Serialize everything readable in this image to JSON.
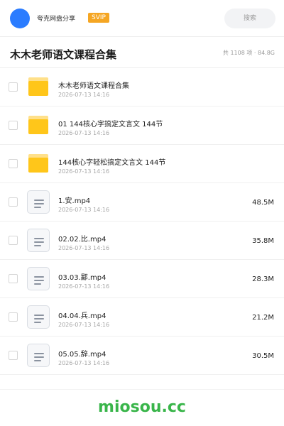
{
  "header": {
    "brand": "夸克网盘分享",
    "badge": "SVIP",
    "search_placeholder": "搜索"
  },
  "folder": {
    "title": "木木老师语文课程合集",
    "meta": "共 1108 项 · 84.8G"
  },
  "items": [
    {
      "type": "folder",
      "name": "木木老师语文课程合集",
      "date": "2026-07-13 14:16",
      "size": ""
    },
    {
      "type": "folder",
      "name": "01 144核心字搞定文言文 144节",
      "date": "2026-07-13 14:16",
      "size": ""
    },
    {
      "type": "folder",
      "name": "144核心字轻松搞定文言文 144节",
      "date": "2026-07-13 14:16",
      "size": ""
    },
    {
      "type": "file",
      "name": "1.安.mp4",
      "date": "2026-07-13 14:16",
      "size": "48.5M"
    },
    {
      "type": "file",
      "name": "02.02.比.mp4",
      "date": "2026-07-13 14:16",
      "size": "35.8M"
    },
    {
      "type": "file",
      "name": "03.03.鄙.mp4",
      "date": "2026-07-13 14:16",
      "size": "28.3M"
    },
    {
      "type": "file",
      "name": "04.04.兵.mp4",
      "date": "2026-07-13 14:16",
      "size": "21.2M"
    },
    {
      "type": "file",
      "name": "05.05.辞.mp4",
      "date": "2026-07-13 14:16",
      "size": "30.5M"
    }
  ],
  "colors": {
    "brand_blue": "#2b7cff",
    "svip_orange": "#f5a623",
    "folder_yellow": "#ffc61a",
    "watermark_green": "#39b54a"
  },
  "icons": {
    "folder": "folder-icon",
    "file": "file-icon"
  },
  "watermark": "miosou.cc"
}
